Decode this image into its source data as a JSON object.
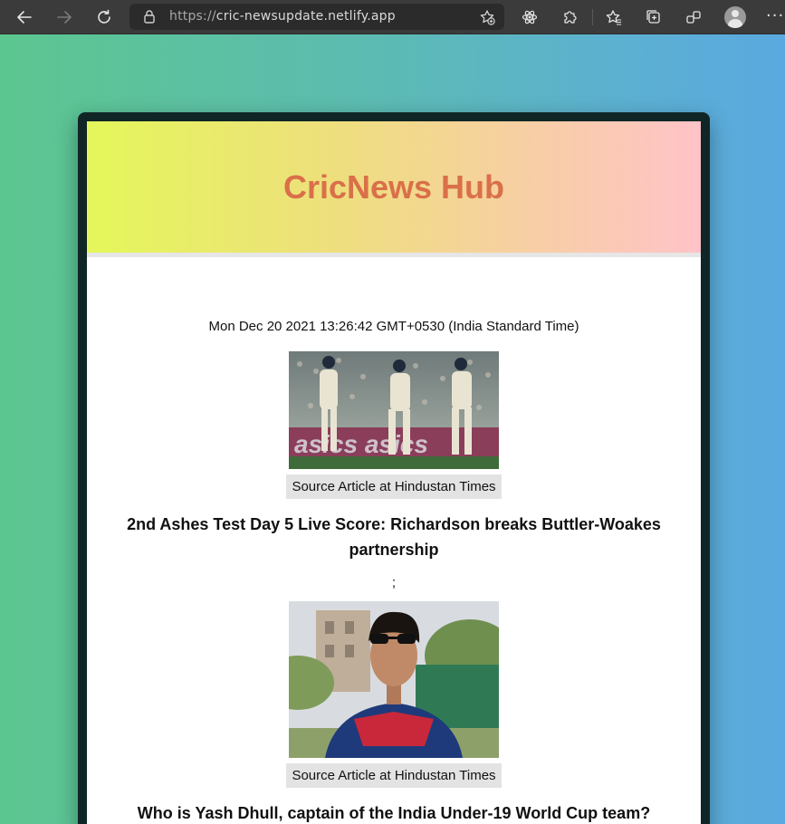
{
  "browser": {
    "url_protocol": "https://",
    "url_host": "cric-newsupdate.netlify.app"
  },
  "app": {
    "title": "CricNews Hub",
    "timestamp": "Mon Dec 20 2021 13:26:42 GMT+0530 (India Standard Time)"
  },
  "articles": [
    {
      "source_label": "Source Article at Hindustan Times",
      "headline": "2nd Ashes Test Day 5 Live Score: Richardson breaks Buttler-Woakes partnership",
      "separator": ";"
    },
    {
      "source_label": "Source Article at Hindustan Times",
      "headline": "Who is Yash Dhull, captain of the India Under-19 World Cup team?"
    }
  ],
  "colors": {
    "title": "#d9704a",
    "frame": "#102626"
  }
}
